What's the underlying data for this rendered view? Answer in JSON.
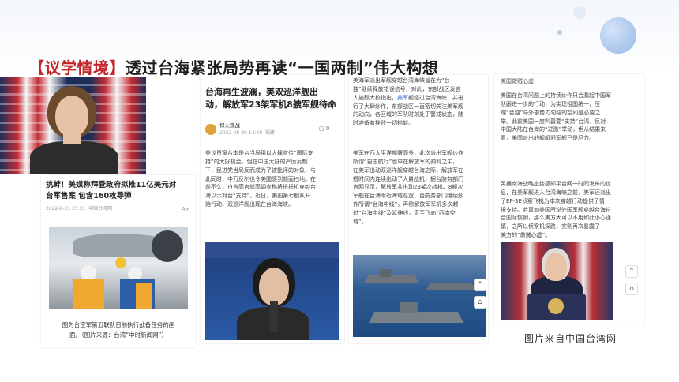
{
  "headline": {
    "tag": "【议学情境】",
    "text": "透过台海紧张局势再读“一国两制”伟大构想"
  },
  "card1": {
    "title_line1": "挑衅！美媒称拜登政府拟推11亿美元对",
    "title_line2": "台军售案 包含160枚导弹",
    "meta_date": "2022-8-31 15:31",
    "meta_source": "中国台湾网",
    "font_btn": "A+",
    "caption_line1": "图为台空军第五联队日前执行战备任务的画",
    "caption_line2": "面。（图片来源：台湾“中时新闻网”）"
  },
  "card2": {
    "title_line1": "台海再生波澜，美双巡洋舰出",
    "title_line2": "动，解放军23架军机8艘军舰待命",
    "author": "博火观战",
    "meta_date": "2022-08-30 14:48",
    "meta_loc": "福建",
    "comment_count": "0",
    "body": [
      "美议员窜台本是台当局用以大肆宣传“国际支",
      "持”的大好机会，但在中国大陆的严厉反制",
      "下，民进党当局反而成为了被批评的对象，与",
      "此同时，中万反制也令美国感到颜面扫地。在",
      "前不久，白宫高官就高调宣称将抵抵机穿越台",
      "海以示对台“支持”，近日，美国第七舰队开",
      "始行动，双巡洋舰出现在台海海峡。"
    ]
  },
  "card3": {
    "para1_pre": [
      "美海军派出军舰穿越台湾海峡旨在为“台",
      "独”继续释放错误信号，对此，东部战区发言",
      "人施毅大校指出，"
    ],
    "para1_link": "美军",
    "para1_post": [
      "舰经过台湾海峡，并进",
      "行了大肆炒作，东部战区一直密切关注美军舰",
      "的动向，各区域的军队时刻处于警戒状态，随",
      "时准备着挫败一切挑衅。"
    ],
    "para2": [
      "美军在西太平洋部署颇多，此次派出军舰炒作",
      "所谓“自由航行”也早在解放军的预料之中，",
      "在美军出动双巡洋舰穿越台海之际，解放军在",
      "短时间内连续出动了大量战机，据台防务部门",
      "官网显示，解放军共出动23架次战机、8艘次",
      "军舰在台海附近海域巡逻，台防务部门继续炒",
      "作所谓“台海中线”，声称解放军军机多次越",
      "过“台海中线”及延伸线，直至飞向“西南空",
      "域”。"
    ]
  },
  "card4": {
    "top_label": "美国做贼心虚",
    "para1": [
      "美国在台湾问题上的持续炒作只会激起中国军",
      "队跟进一步的行动，为实现祖国统一，压",
      "缩“台独”与外部势力勾结的空间是必要之",
      "举。此前美国一度叫嚣要“支持”台湾，反对",
      "中国大陆在台海的“过激”举动，但从结果来",
      "看，美国派出的舰艇旧军舰已是尽力。"
    ],
    "para2": [
      "另据南海战略态势感知平台网一时间发布的信",
      "息，在美军舰进入台湾海峡之前，美军还派出",
      "了EP-3E侦察飞机为本次穿越行动提供了情",
      "报支持。若真如美国所说外国军舰穿越台海符",
      "合国际惯例，那么美方大可以不用如此小心谨",
      "慎，之所以侦察机探路，实则再次暴露了",
      "美方的“做贼心虚”。"
    ]
  },
  "side_buttons": {
    "top": "⌃",
    "home": "⌂"
  },
  "source_note": "——图片来自中国台湾网"
}
